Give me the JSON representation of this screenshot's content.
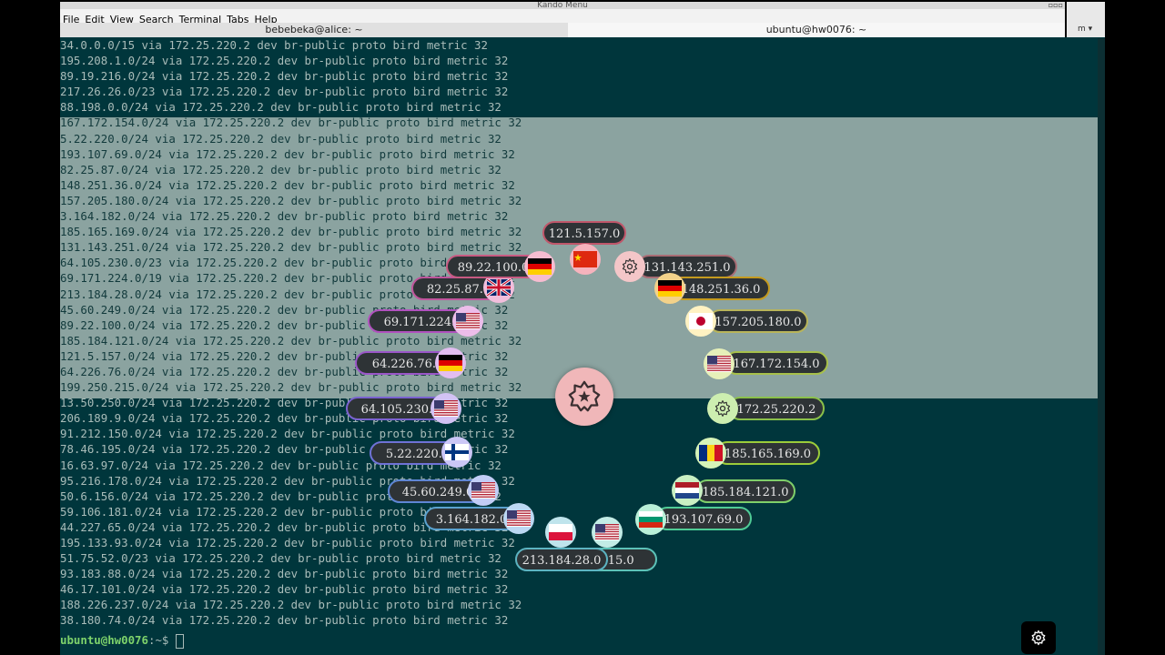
{
  "window": {
    "title": "Kando Menu"
  },
  "menu": [
    "File",
    "Edit",
    "View",
    "Search",
    "Terminal",
    "Tabs",
    "Help"
  ],
  "tabs": [
    "bebebeka@alice: ~",
    "ubuntu@hw0076: ~"
  ],
  "terminal": {
    "lines": [
      "34.0.0.0/15 via 172.25.220.2 dev br-public proto bird metric 32",
      "195.208.1.0/24 via 172.25.220.2 dev br-public proto bird metric 32",
      "89.19.216.0/24 via 172.25.220.2 dev br-public proto bird metric 32",
      "217.26.26.0/23 via 172.25.220.2 dev br-public proto bird metric 32",
      "88.198.0.0/24 via 172.25.220.2 dev br-public proto bird metric 32",
      "167.172.154.0/24 via 172.25.220.2 dev br-public proto bird metric 32",
      "5.22.220.0/24 via 172.25.220.2 dev br-public proto bird metric 32",
      "193.107.69.0/24 via 172.25.220.2 dev br-public proto bird metric 32",
      "82.25.87.0/24 via 172.25.220.2 dev br-public proto bird metric 32",
      "148.251.36.0/24 via 172.25.220.2 dev br-public proto bird metric 32",
      "157.205.180.0/24 via 172.25.220.2 dev br-public proto bird metric 32",
      "3.164.182.0/24 via 172.25.220.2 dev br-public proto bird metric 32",
      "185.165.169.0/24 via 172.25.220.2 dev br-public proto bird metric 32",
      "131.143.251.0/24 via 172.25.220.2 dev br-public proto bird metric 32",
      "64.105.230.0/23 via 172.25.220.2 dev br-public proto bird metric 32",
      "69.171.224.0/19 via 172.25.220.2 dev br-public proto bird metric 32",
      "213.184.28.0/24 via 172.25.220.2 dev br-public proto bird metric 32",
      "45.60.249.0/24 via 172.25.220.2 dev br-public proto bird metric 32",
      "89.22.100.0/24 via 172.25.220.2 dev br-public proto bird metric 32",
      "185.184.121.0/24 via 172.25.220.2 dev br-public proto bird metric 32",
      "121.5.157.0/24 via 172.25.220.2 dev br-public proto bird metric 32",
      "64.226.76.0/24 via 172.25.220.2 dev br-public proto bird metric 32",
      "199.250.215.0/24 via 172.25.220.2 dev br-public proto bird metric 32",
      "13.50.250.0/24 via 172.25.220.2 dev br-public proto bird metric 32",
      "206.189.9.0/24 via 172.25.220.2 dev br-public proto bird metric 32",
      "91.212.150.0/24 via 172.25.220.2 dev br-public proto bird metric 32",
      "78.46.195.0/24 via 172.25.220.2 dev br-public proto bird metric 32",
      "16.63.97.0/24 via 172.25.220.2 dev br-public proto bird metric 32",
      "95.216.178.0/24 via 172.25.220.2 dev br-public proto bird metric 32",
      "50.6.156.0/24 via 172.25.220.2 dev br-public proto bird metric 32",
      "59.106.181.0/24 via 172.25.220.2 dev br-public proto bird metric 32",
      "44.227.65.0/24 via 172.25.220.2 dev br-public proto bird metric 32",
      "195.133.93.0/24 via 172.25.220.2 dev br-public proto bird metric 32",
      "51.75.52.0/23 via 172.25.220.2 dev br-public proto bird metric 32",
      "93.183.88.0/24 via 172.25.220.2 dev br-public proto bird metric 32",
      "46.17.101.0/24 via 172.25.220.2 dev br-public proto bird metric 32",
      "188.226.237.0/24 via 172.25.220.2 dev br-public proto bird metric 32",
      "38.180.74.0/24 via 172.25.220.2 dev br-public proto bird metric 32"
    ],
    "prompt": {
      "user": "ubuntu@hw0076",
      "path": ":~$"
    }
  },
  "right_panel": {
    "menu_glyph": "m"
  },
  "kando": {
    "center_icon": "star-gear-icon",
    "items": [
      {
        "label": "121.5.157.0",
        "flag": "china-flag-icon"
      },
      {
        "label": "131.143.251.0",
        "flag": "gear-icon"
      },
      {
        "label": "148.251.36.0",
        "flag": "germany-flag-icon"
      },
      {
        "label": "157.205.180.0",
        "flag": "japan-flag-icon"
      },
      {
        "label": "167.172.154.0",
        "flag": "usa-flag-icon"
      },
      {
        "label": "172.25.220.2",
        "flag": "gear-icon"
      },
      {
        "label": "185.165.169.0",
        "flag": "romania-flag-icon"
      },
      {
        "label": "185.184.121.0",
        "flag": "netherlands-flag-icon"
      },
      {
        "label": "193.107.69.0",
        "flag": "bulgaria-flag-icon"
      },
      {
        "label": ".215.0",
        "flag": "usa-flag-icon"
      },
      {
        "label": "213.184.28.0",
        "flag": "poland-flag-icon"
      },
      {
        "label": "3.164.182.0",
        "flag": "usa-flag-icon"
      },
      {
        "label": "45.60.249.0",
        "flag": "usa-flag-icon"
      },
      {
        "label": "5.22.220.0",
        "flag": "finland-flag-icon"
      },
      {
        "label": "64.105.230.0",
        "flag": "usa-flag-icon"
      },
      {
        "label": "64.226.76.0",
        "flag": "germany-flag-icon"
      },
      {
        "label": "69.171.224.0",
        "flag": "usa-flag-icon"
      },
      {
        "label": "82.25.87.0",
        "flag": "uk-flag-icon"
      },
      {
        "label": "89.22.100.0",
        "flag": "germany-flag-icon"
      }
    ]
  },
  "taskbar": {
    "icon": "gear-icon"
  }
}
